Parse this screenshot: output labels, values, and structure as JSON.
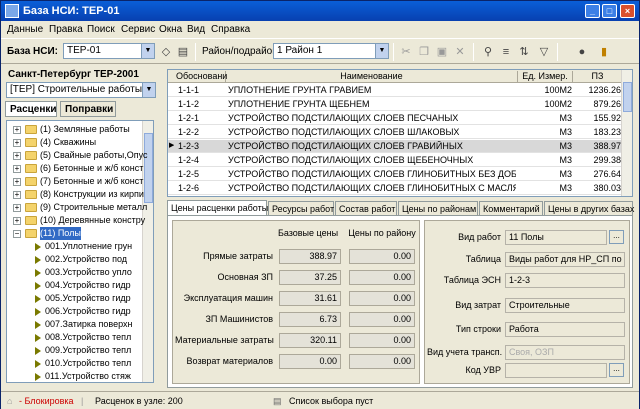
{
  "window": {
    "title": "База НСИ: ТЕР-01"
  },
  "menu": [
    "Данные",
    "Правка",
    "Поиск",
    "Сервис",
    "Окна",
    "Вид",
    "Справка"
  ],
  "toolbar": {
    "base_label": "База НСИ:",
    "base_value": "ТЕР-01",
    "region_label": "Район/подрайон:",
    "region_value": "1 Район 1"
  },
  "left": {
    "region_title": "Санкт-Петербург ТЕР-2001",
    "collection_value": "[ТЕР] Строительные работы",
    "tab_rates": "Расценки",
    "tab_corrections": "Поправки",
    "tree": [
      {
        "type": "folder",
        "label": "(1) Земляные работы"
      },
      {
        "type": "folder",
        "label": "(4) Скважины"
      },
      {
        "type": "folder",
        "label": "(5) Свайные работы,Опус"
      },
      {
        "type": "folder",
        "label": "(6) Бетонные и ж/б конст"
      },
      {
        "type": "folder",
        "label": "(7) Бетонные и ж/б конст"
      },
      {
        "type": "folder",
        "label": "(8) Конструкции из кирпи"
      },
      {
        "type": "folder",
        "label": "(9) Строительные металл"
      },
      {
        "type": "folder",
        "label": "(10) Деревянные констру"
      },
      {
        "type": "folder-open",
        "label": "(11) Полы"
      },
      {
        "type": "item",
        "label": "001.Уплотнение грун"
      },
      {
        "type": "item",
        "label": "002.Устройство под"
      },
      {
        "type": "item",
        "label": "003.Устройство упло"
      },
      {
        "type": "item",
        "label": "004.Устройство гидр"
      },
      {
        "type": "item",
        "label": "005.Устройство гидр"
      },
      {
        "type": "item",
        "label": "006.Устройство гидр"
      },
      {
        "type": "item",
        "label": "007.Затирка поверхн"
      },
      {
        "type": "item",
        "label": "008.Устройство тепл"
      },
      {
        "type": "item",
        "label": "009.Устройство тепл"
      },
      {
        "type": "item",
        "label": "010.Устройство тепл"
      },
      {
        "type": "item",
        "label": "011.Устройство стяж"
      }
    ]
  },
  "grid": {
    "headers": [
      "Обосновани",
      "Наименование",
      "Ед. Измер.",
      "ПЗ"
    ],
    "rows": [
      [
        "1-1-1",
        "УПЛОТНЕНИЕ ГРУНТА ГРАВИЕМ",
        "100М2",
        "1236.26"
      ],
      [
        "1-1-2",
        "УПЛОТНЕНИЕ ГРУНТА ЩЕБНЕМ",
        "100М2",
        "879.26"
      ],
      [
        "1-2-1",
        "УСТРОЙСТВО ПОДСТИЛАЮЩИХ СЛОЕВ ПЕСЧАНЫХ",
        "М3",
        "155.92"
      ],
      [
        "1-2-2",
        "УСТРОЙСТВО ПОДСТИЛАЮЩИХ СЛОЕВ ШЛАКОВЫХ",
        "М3",
        "183.23"
      ],
      [
        "1-2-3",
        "УСТРОЙСТВО ПОДСТИЛАЮЩИХ СЛОЕВ ГРАВИЙНЫХ",
        "М3",
        "388.97"
      ],
      [
        "1-2-4",
        "УСТРОЙСТВО ПОДСТИЛАЮЩИХ СЛОЕВ ЩЕБЕНОЧНЫХ",
        "М3",
        "299.38"
      ],
      [
        "1-2-5",
        "УСТРОЙСТВО ПОДСТИЛАЮЩИХ СЛОЕВ ГЛИНОБИТНЫХ БЕЗ ДОБАВОК",
        "М3",
        "276.64"
      ],
      [
        "1-2-6",
        "УСТРОЙСТВО ПОДСТИЛАЮЩИХ СЛОЕВ ГЛИНОБИТНЫХ С МАСЛЯНИСТ",
        "М3",
        "380.03"
      ]
    ]
  },
  "detail_tabs": [
    "Цены расценки работы",
    "Ресурсы работ",
    "Состав работ",
    "Цены по районам",
    "Комментарий",
    "Цены в других базах"
  ],
  "prices": {
    "col_base": "Базовые цены",
    "col_region": "Цены по району",
    "rows": [
      {
        "label": "Прямые затраты",
        "base": "388.97",
        "region": "0.00"
      },
      {
        "label": "Основная ЗП",
        "base": "37.25",
        "region": "0.00"
      },
      {
        "label": "Эксплуатация машин",
        "base": "31.61",
        "region": "0.00"
      },
      {
        "label": "ЗП Машинистов",
        "base": "6.73",
        "region": "0.00"
      },
      {
        "label": "Материальные затраты",
        "base": "320.11",
        "region": "0.00"
      },
      {
        "label": "Возврат материалов",
        "base": "0.00",
        "region": "0.00"
      }
    ]
  },
  "props": [
    {
      "label": "Вид работ",
      "value": "11 Полы"
    },
    {
      "label": "Таблица",
      "value": "Виды работ для НР_СП по"
    },
    {
      "label": "Таблица ЭСН",
      "value": "1-2-3"
    },
    {
      "label": "Вид затрат",
      "value": "Строительные"
    },
    {
      "label": "Тип строки",
      "value": "Работа"
    },
    {
      "label": "Вид учета трансп.",
      "value": "Своя, ОЗП"
    },
    {
      "label": "Код УВР",
      "value": ""
    }
  ],
  "status": {
    "lock": "- Блокировка",
    "count": "Расценок в узле: 200",
    "selection": "Список выбора пуст"
  }
}
